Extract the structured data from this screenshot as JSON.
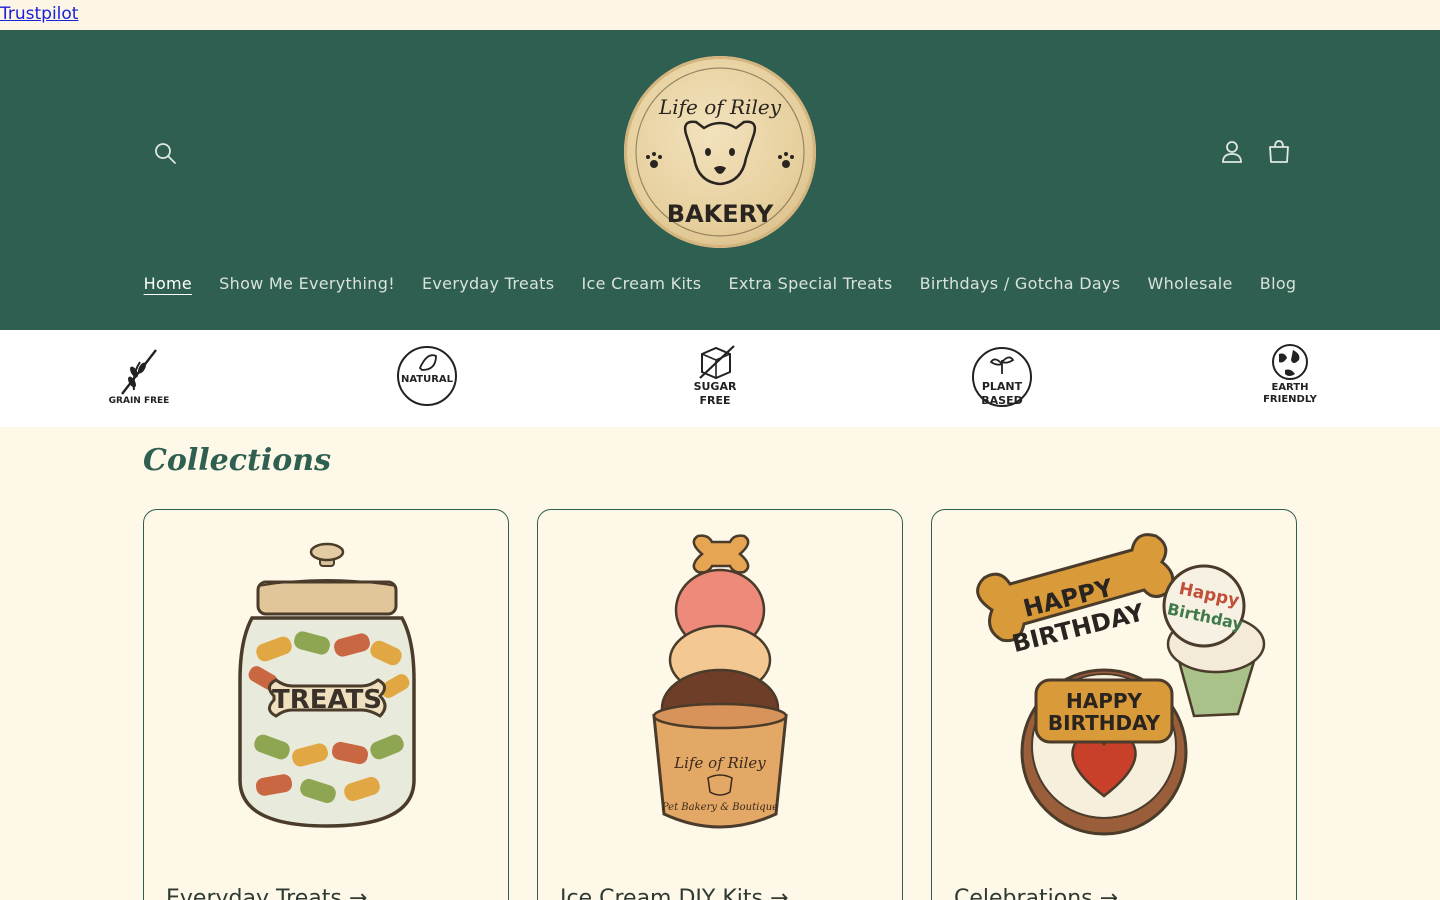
{
  "topbar": {
    "link": "Trustpilot"
  },
  "header": {
    "logo": {
      "text_top": "Life of Riley",
      "text_bottom": "BAKERY"
    },
    "icons": {
      "search": "search-icon",
      "account": "account-icon",
      "cart": "cart-icon"
    }
  },
  "nav": {
    "items": [
      {
        "label": "Home"
      },
      {
        "label": "Show Me Everything!"
      },
      {
        "label": "Everyday Treats"
      },
      {
        "label": "Ice Cream Kits"
      },
      {
        "label": "Extra Special Treats"
      },
      {
        "label": "Birthdays / Gotcha Days"
      },
      {
        "label": "Wholesale"
      },
      {
        "label": "Blog"
      }
    ]
  },
  "badges": [
    {
      "icon": "grain-free-icon",
      "line1": "GRAIN FREE",
      "line2": ""
    },
    {
      "icon": "natural-icon",
      "line1": "NATURAL",
      "line2": ""
    },
    {
      "icon": "sugar-free-icon",
      "line1": "SUGAR",
      "line2": "FREE"
    },
    {
      "icon": "plant-based-icon",
      "line1": "PLANT",
      "line2": "BASED"
    },
    {
      "icon": "earth-friendly-icon",
      "line1": "EARTH",
      "line2": "FRIENDLY"
    }
  ],
  "collections": {
    "title": "Collections",
    "cards": [
      {
        "title": "Everyday Treats →",
        "art_text": "TREATS"
      },
      {
        "title": "Ice Cream DIY Kits →",
        "art_text_top": "Life of Riley",
        "art_text_bottom": "Pet Bakery & Boutique"
      },
      {
        "title": "Celebrations →",
        "art_text_1": "HAPPY",
        "art_text_2": "BIRTHDAY",
        "art_text_3": "Happy",
        "art_text_4": "Birthday"
      }
    ]
  },
  "colors": {
    "header_bg": "#2f5f50",
    "page_bg": "#fdf8e8",
    "link": "#1a21d6"
  }
}
